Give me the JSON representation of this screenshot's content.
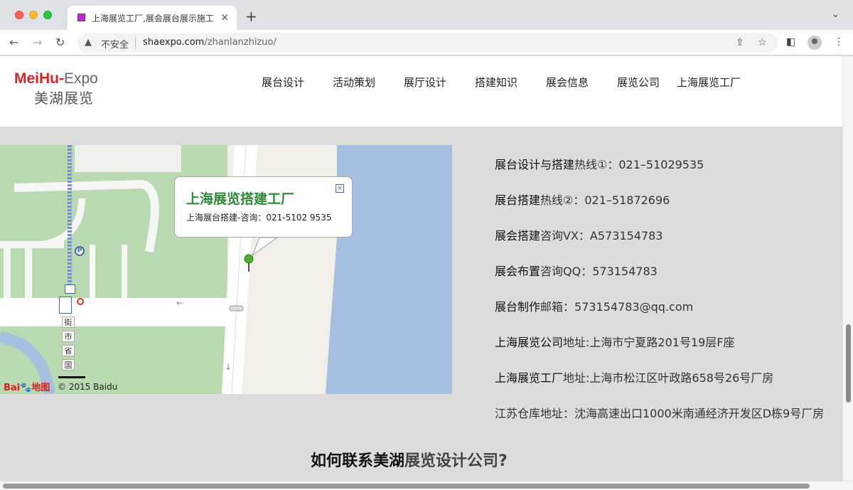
{
  "browser": {
    "tab_title": "上海展览工厂,展会展台展示施工",
    "tab_close": "×",
    "new_tab": "+",
    "tab_menu": "⌄",
    "security_label": "不安全",
    "url_host": "shaexpo.com",
    "url_path": "/zhanlanzhizuo/"
  },
  "header": {
    "logo_en_red": "MeiHu-",
    "logo_en_gray": "Expo",
    "logo_cn": "美湖展览",
    "nav": [
      "展台设计",
      "活动策划",
      "展厅设计",
      "搭建知识",
      "展会信息",
      "展览公司",
      "上海展览工厂"
    ]
  },
  "map": {
    "popup_title": "上海展览搭建工厂",
    "popup_subtitle": "上海展台搭建-咨询：021-5102 9535",
    "popup_close": "×",
    "copyright": "© 2015 Baidu",
    "logo_bai": "Bai",
    "logo_paw": "🐾",
    "logo_map": "地图",
    "parking": "P",
    "street_chars": [
      "街",
      "市",
      "省",
      "国"
    ]
  },
  "contacts": [
    {
      "strong": "展台设计与搭建",
      "rest": "热线①：021–51029535"
    },
    {
      "strong": "展台搭建",
      "rest": "热线②：021–51872696"
    },
    {
      "strong": "展会搭建",
      "rest": "咨询VX：A573154783"
    },
    {
      "strong": "展会布置",
      "rest": "咨询QQ：573154783"
    },
    {
      "strong": "展台制作",
      "rest": "邮箱：573154783@qq.com"
    },
    {
      "strong": "上海展览公司",
      "rest": "地址:上海市宁夏路201号19层F座"
    },
    {
      "strong": "上海展览工厂",
      "rest": "地址:上海市松江区叶政路658号26号厂房"
    },
    {
      "strong": "",
      "rest": "江苏仓库地址：沈海高速出口1000米南通经济开发区D栋9号厂房"
    }
  ],
  "section": {
    "title_strong": "如何联系美湖",
    "title_light": "展览设计公司?"
  }
}
